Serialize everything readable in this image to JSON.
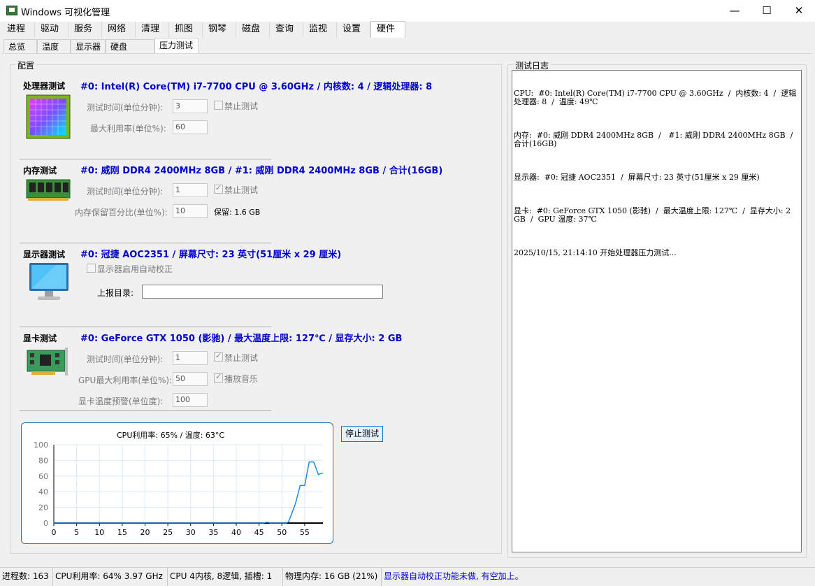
{
  "window": {
    "title": "Windows 可视化管理",
    "minimize": "—",
    "maximize": "☐",
    "close": "✕"
  },
  "tabs_main": [
    "进程",
    "驱动",
    "服务",
    "网络",
    "清理",
    "抓图",
    "钢琴",
    "磁盘",
    "查询",
    "监视",
    "设置",
    "硬件"
  ],
  "tabs_sub": [
    "总览",
    "温度",
    "显示器",
    "硬盘 SMART",
    "压力测试"
  ],
  "config_title": "配置",
  "log_title": "测试日志",
  "cpu": {
    "label": "处理器测试",
    "info": "#0: Intel(R) Core(TM) i7-7700 CPU @ 3.60GHz  / 内核数: 4  / 逻辑处理器: 8",
    "time_label": "测试时间(单位分钟):",
    "time_value": "3",
    "disable_label": "禁止测试",
    "max_label": "最大利用率(单位%):",
    "max_value": "60"
  },
  "mem": {
    "label": "内存测试",
    "info": "#0: 威刚 DDR4 2400MHz 8GB  /  #1: 威刚 DDR4 2400MHz 8GB  / 合计(16GB)",
    "time_label": "测试时间(单位分钟):",
    "time_value": "1",
    "disable_label": "禁止测试",
    "reserve_label": "内存保留百分比(单位%):",
    "reserve_value": "10",
    "reserve_text": "保留: 1.6 GB"
  },
  "display": {
    "label": "显示器测试",
    "info": "#0: 冠捷 AOC2351  / 屏幕尺寸: 23 英寸(51厘米 x 29 厘米)",
    "auto_label": "显示器启用自动校正",
    "report_label": "上报目录:",
    "report_value": ""
  },
  "gpu": {
    "label": "显卡测试",
    "info": "#0: GeForce GTX 1050 (影驰) / 最大温度上限: 127℃ / 显存大小: 2 GB",
    "time_label": "测试时间(单位分钟):",
    "time_value": "1",
    "disable_label": "禁止测试",
    "max_label": "GPU最大利用率(单位%):",
    "max_value": "50",
    "music_label": "播放音乐",
    "temp_label": "显卡温度预警(单位度):",
    "temp_value": "100"
  },
  "chart_data": {
    "type": "line",
    "title": "CPU利用率: 65% / 温度: 63°C",
    "xlabel": "",
    "ylabel": "",
    "xlim": [
      0,
      59
    ],
    "ylim": [
      0,
      100
    ],
    "x_ticks": [
      0,
      5,
      10,
      15,
      20,
      25,
      30,
      35,
      40,
      45,
      50,
      55
    ],
    "y_ticks": [
      0,
      20,
      40,
      60,
      80,
      100
    ],
    "grid": true,
    "x": [
      0,
      46,
      46.5,
      47,
      47.5,
      51,
      51.5,
      53,
      54,
      55,
      56,
      57,
      58,
      59
    ],
    "values": [
      0,
      0,
      1,
      1,
      0,
      0,
      2,
      25,
      48,
      48,
      78,
      78,
      62,
      64
    ],
    "color": "#1e88e5"
  },
  "stop_button": "停止测试",
  "log": [
    "CPU:  #0: Intel(R) Core(TM) i7-7700 CPU @ 3.60GHz  /  内核数: 4  /  逻辑处理器: 8  /  温度: 49℃",
    "内存:  #0: 威刚 DDR4 2400MHz 8GB  /   #1: 威刚 DDR4 2400MHz 8GB  /  合计(16GB)",
    "显示器:  #0: 冠捷 AOC2351  /  屏幕尺寸: 23 英寸(51厘米 x 29 厘米)",
    "显卡:  #0: GeForce GTX 1050 (影驰)  /  最大温度上限: 127℃  /  显存大小: 2 GB  /  GPU 温度: 37℃",
    "2025/10/15, 21:14:10 开始处理器压力测试..."
  ],
  "status": {
    "procs": "进程数: 163",
    "cpu": "CPU利用率: 64%  3.97 GHz",
    "cores": "CPU 4内核, 8逻辑, 插槽: 1",
    "mem": "物理内存: 16 GB (21%)",
    "msg": "显示器自动校正功能未做, 有空加上。",
    "msg_color": "#0000cd"
  }
}
